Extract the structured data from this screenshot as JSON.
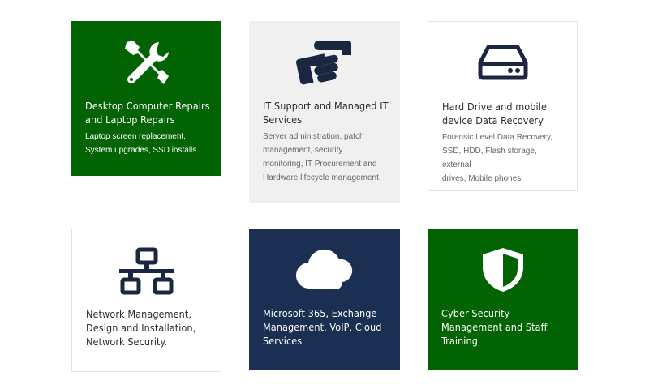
{
  "colors": {
    "green": "#016301",
    "grey": "#f0f0f0",
    "navy": "#1b2f52",
    "icon_dark": "#1b2640"
  },
  "cards": [
    {
      "icon": "tools-icon",
      "title": "Desktop Computer Repairs\nand Laptop Repairs",
      "description": "Laptop screen replacement,\nSystem upgrades, SSD installs"
    },
    {
      "icon": "handshake-icon",
      "title": "IT Support and Managed IT\nServices",
      "description": "Server administration, patch\nmanagement, security\nmonitoring, IT Procurement and\nHardware lifecycle management."
    },
    {
      "icon": "hard-drive-icon",
      "title": "Hard Drive and mobile\ndevice Data Recovery",
      "description": "Forensic Level Data Recovery,\nSSD, HDD, Flash storage, external\ndrives, Mobile phones"
    },
    {
      "icon": "network-icon",
      "title": "Network Management,\nDesign and Installation,\nNetwork Security."
    },
    {
      "icon": "cloud-icon",
      "title": "Microsoft 365, Exchange\nManagement, VoIP, Cloud\nServices"
    },
    {
      "icon": "shield-icon",
      "title": "Cyber Security\nManagement and Staff\nTraining"
    }
  ]
}
